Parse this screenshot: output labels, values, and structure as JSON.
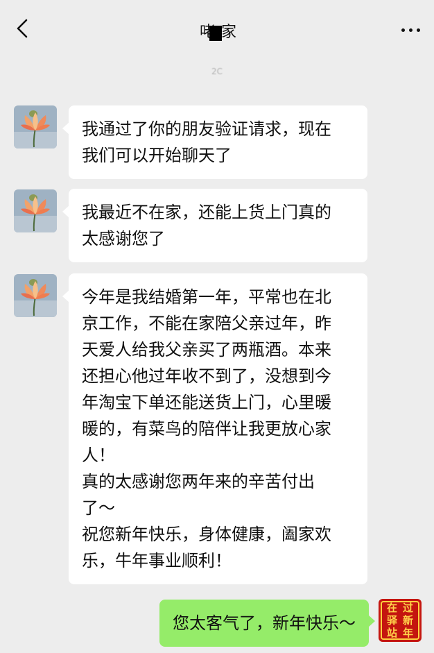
{
  "header": {
    "title": "咾 家",
    "back_icon": "chevron-left-icon",
    "more_icon": "more-horizontal-icon"
  },
  "timestamp": "2C",
  "messages": [
    {
      "side": "left",
      "lines": [
        "我通过了你的朋友验证请求，现在",
        "我们可以开始聊天了"
      ]
    },
    {
      "side": "left",
      "lines": [
        "我最近不在家，还能上货上门真的",
        "太感谢您了"
      ]
    },
    {
      "side": "left",
      "lines": [
        "今年是我结婚第一年，平常也在北",
        "京工作，不能在家陪父亲过年，昨",
        "天爱人给我父亲买了两瓶酒。本来",
        "还担心他过年收不到了，没想到今",
        "年淘宝下单还能送货上门，心里暖",
        "暖的，有菜鸟的陪伴让我更放心家",
        "人！",
        "真的太感谢您两年来的辛苦付出",
        "了～",
        "祝您新年快乐，身体健康，阖家欢",
        "乐，牛年事业顺利！"
      ]
    },
    {
      "side": "right",
      "lines": [
        "您太客气了，新年快乐～"
      ]
    }
  ],
  "self_avatar": {
    "chars": [
      "在",
      "过",
      "驿",
      "新",
      "站",
      "年"
    ]
  },
  "colors": {
    "background": "#ededed",
    "incoming_bubble": "#ffffff",
    "outgoing_bubble": "#95ec69",
    "self_avatar_bg": "#c4150f"
  }
}
